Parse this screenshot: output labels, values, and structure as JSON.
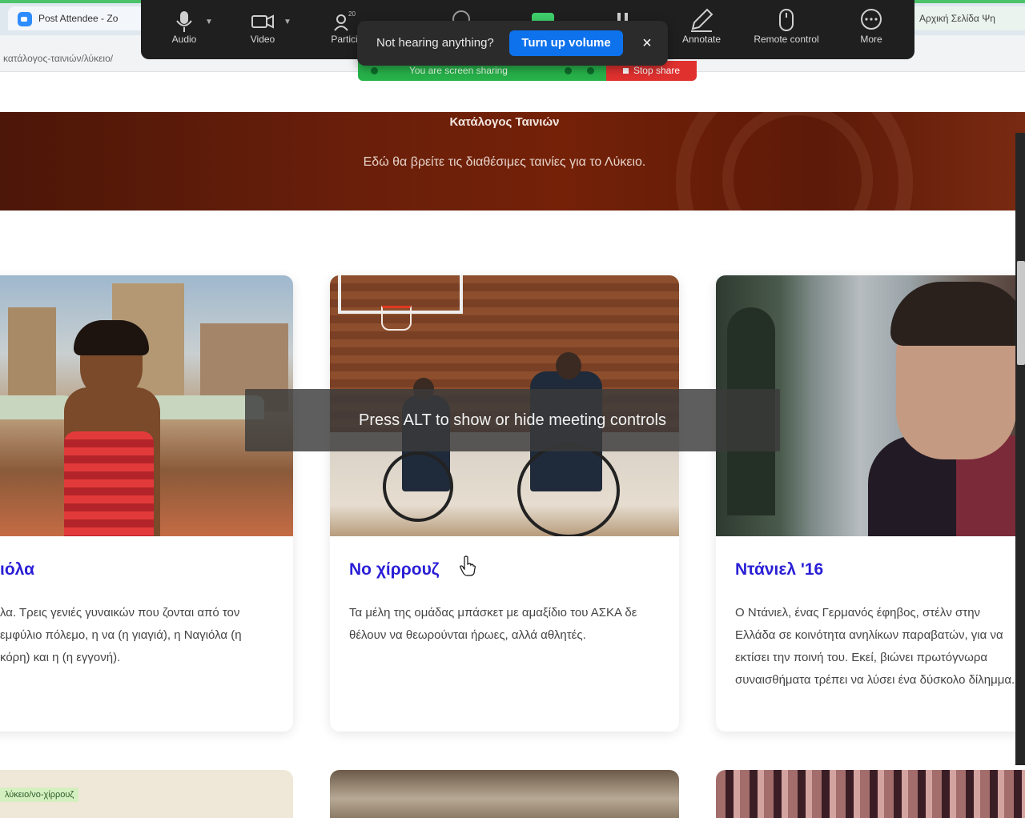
{
  "browser": {
    "tab_title": "Post Attendee - Zo",
    "tab_right_title": "Αρχική Σελίδα Ψη",
    "address": "κατάλογος-ταινιών/λύκειο/"
  },
  "zoom_toolbar": {
    "buttons": [
      {
        "label": "Audio"
      },
      {
        "label": "Video"
      },
      {
        "label": "Partici"
      },
      {
        "label": ""
      },
      {
        "label": ""
      },
      {
        "label": ""
      },
      {
        "label": "Annotate"
      },
      {
        "label": "Remote control"
      },
      {
        "label": "More"
      }
    ],
    "participants_count": "20"
  },
  "notification": {
    "message": "Not hearing anything?",
    "action_label": "Turn up volume",
    "close_symbol": "×"
  },
  "share_bar": {
    "sharing_text": "You are screen sharing",
    "stop_label": "Stop share",
    "sharing_color": "#27b24a",
    "stop_color": "#e0312f"
  },
  "banner": {
    "title": "Κατάλογος Ταινιών",
    "subtitle": "Εδώ θα βρείτε τις διαθέσιμες ταινίες για το Λύκειο."
  },
  "cards": [
    {
      "title": "ιόλα",
      "description": "λα. Τρεις γενιές γυναικών που ζονται από τον εμφύλιο πόλεμο, η να (η γιαγιά), η Ναγιόλα (η κόρη) και η (η εγγονή)."
    },
    {
      "title": "Νο χίρρουζ",
      "description": "Τα μέλη της ομάδας μπάσκετ με αμαξίδιο του ΑΣΚΑ δε θέλουν να θεωρούνται ήρωες, αλλά αθλητές."
    },
    {
      "title": "Ντάνιελ '16",
      "description": "Ο Ντάνιελ, ένας Γερμανός έφηβος, στέλν στην Ελλάδα σε κοινότητα ανηλίκων παραβατών, για να εκτίσει την ποινή του. Εκεί, βιώνει πρωτόγνωρα συναισθήματα τρέπει να λύσει ένα δύσκολο δίλημμα."
    }
  ],
  "bottom_cards": {
    "tag": "λύκειο/νο-χίρρουζ"
  },
  "overlay": {
    "alt_hint": "Press ALT to show or hide meeting controls"
  },
  "colors": {
    "accent_blue": "#0e72ed",
    "card_title": "#2a1fd6",
    "banner_bg": "#6a1f0a"
  }
}
